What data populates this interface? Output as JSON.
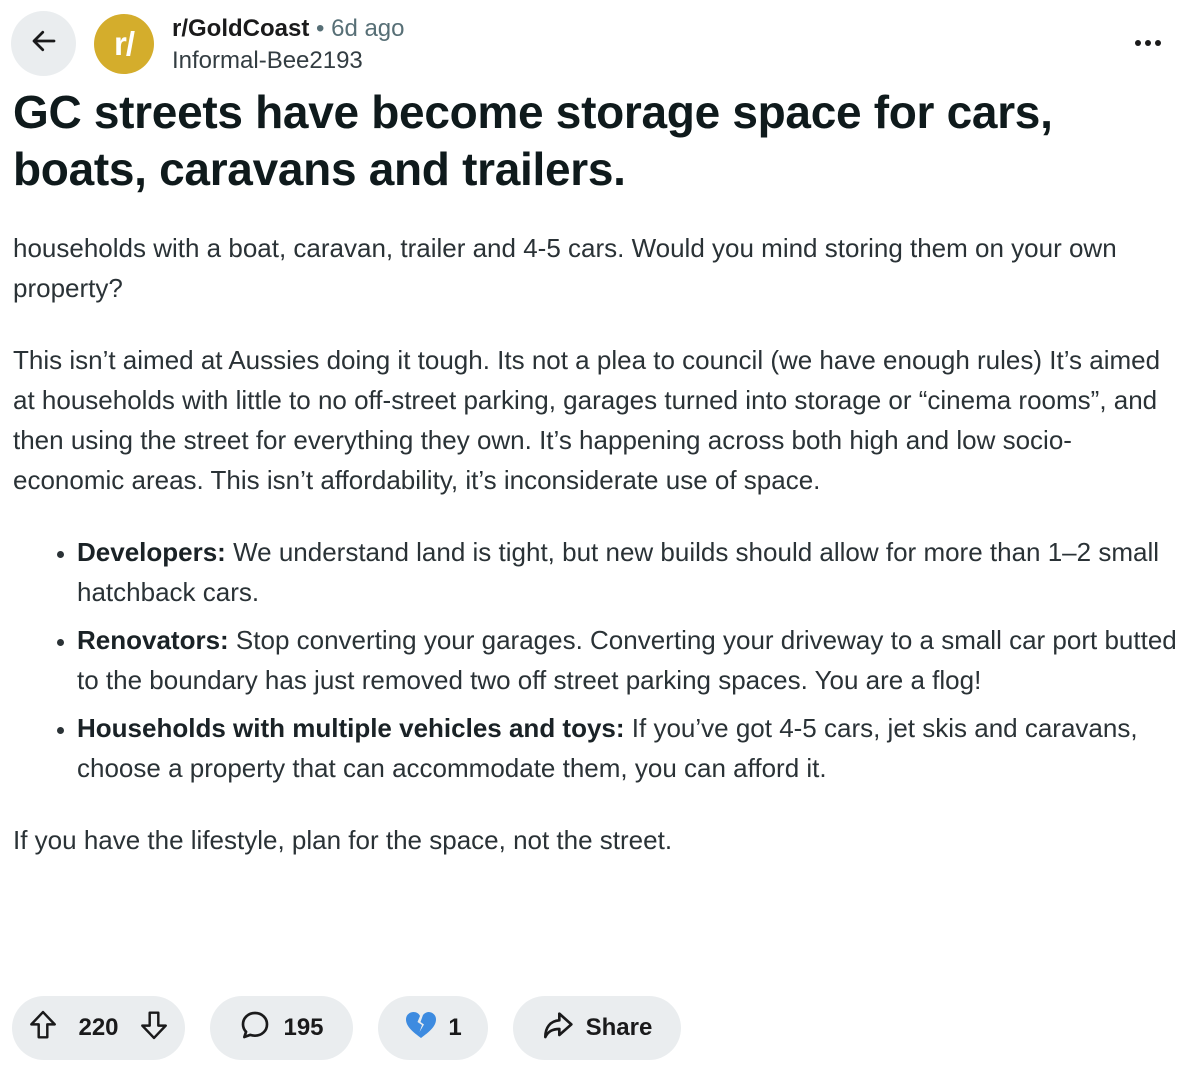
{
  "header": {
    "back_icon": "arrow-left-icon",
    "avatar_text": "r/",
    "avatar_color": "#d4ad2c",
    "subreddit": "r/GoldCoast",
    "separator": "•",
    "time_ago": "6d ago",
    "author": "Informal-Bee2193",
    "more_icon": "more-options-icon"
  },
  "post": {
    "title": "GC streets have become storage space for cars, boats, caravans and trailers.",
    "intro": "households with a boat, caravan, trailer and 4-5 cars. Would you mind storing them on your own property?",
    "paragraph": "This isn’t aimed at Aussies doing it tough. Its not a plea to council (we have enough rules) It’s aimed at households with little to no off-street parking, garages turned into storage or “cinema rooms”, and then using the street for everything they own. It’s happening across both high and low socio-economic areas. This isn’t affordability, it’s inconsiderate use of space.",
    "bullets": [
      {
        "label": "Developers:",
        "text": " We understand land is tight, but new builds should allow for more than 1–2 small hatchback cars."
      },
      {
        "label": "Renovators:",
        "text": " Stop converting your garages. Converting your driveway to a small car port butted to the boundary has just removed two off street parking spaces. You are a flog!"
      },
      {
        "label": "Households with multiple vehicles and toys:",
        "text": " If you’ve got 4-5 cars, jet skis and caravans, choose a property that can accommodate them, you can afford it."
      }
    ],
    "closing": "If you have the lifestyle, plan for the space, not the street."
  },
  "actions": {
    "upvote_icon": "upvote-arrow-icon",
    "score": "220",
    "downvote_icon": "downvote-arrow-icon",
    "comment_icon": "comment-bubble-icon",
    "comments": "195",
    "award_icon": "broken-heart-icon",
    "awards": "1",
    "share_icon": "share-arrow-icon",
    "share_label": "Share"
  }
}
